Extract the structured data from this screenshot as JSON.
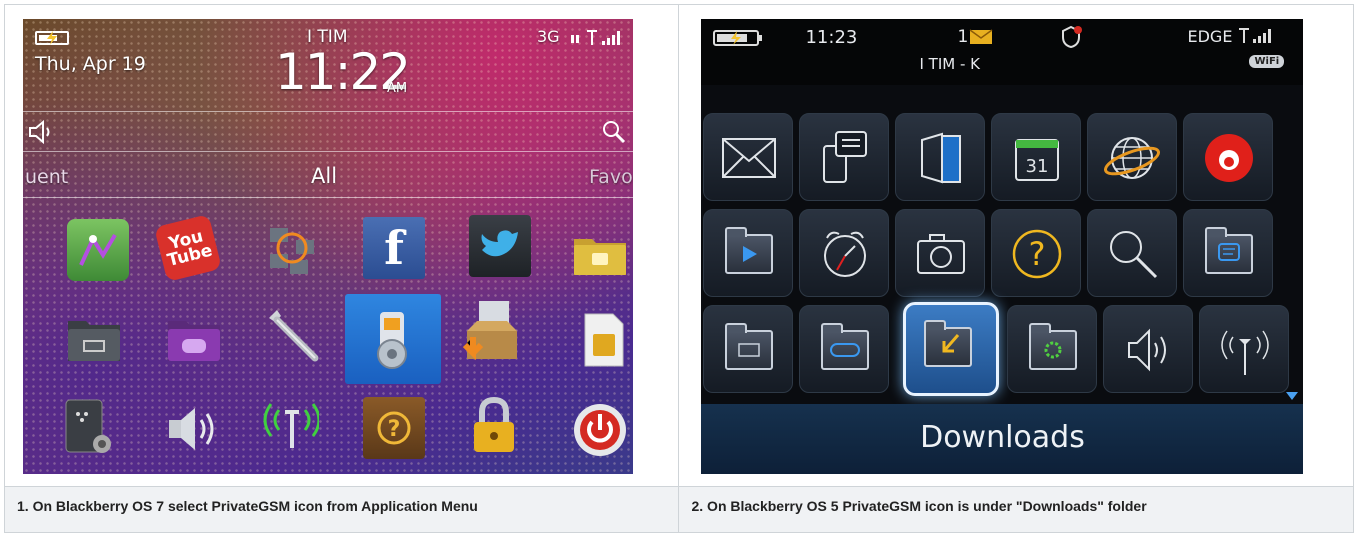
{
  "captions": [
    "1. On Blackberry OS 7 select PrivateGSM icon from Application Menu",
    "2. On Blackberry OS 5 PrivateGSM icon is under \"Downloads\" folder"
  ],
  "os7": {
    "carrier": "I TIM",
    "network": "3G",
    "date": "Thu, Apr 19",
    "time": "11:22",
    "ampm": "AM",
    "tabs": [
      "uent",
      "All",
      "Favo"
    ],
    "youtube_text": "You\nTube",
    "facebook_letter": "f",
    "icons": [
      "maps-icon",
      "youtube-icon",
      "social-feeds-icon",
      "facebook-icon",
      "twitter-icon",
      "messages-folder-icon",
      "folder-icon",
      "games-folder-icon",
      "wrench-icon",
      "privategsm-icon",
      "app-installer-icon",
      "sim-card-icon",
      "blackberry-options-icon",
      "speaker-icon",
      "wifi-icon",
      "help-icon",
      "lock-icon",
      "power-icon"
    ]
  },
  "os5": {
    "time": "11:23",
    "msg_count": "1",
    "carrier": "I TIM - K",
    "network": "EDGE",
    "wifi": "WiFi",
    "calendar_day": "31",
    "selected_label": "Downloads",
    "icons": [
      "mail-icon",
      "messenger-icon",
      "contacts-icon",
      "calendar-icon",
      "browser-icon",
      "vodafone-icon",
      "media-folder-icon",
      "clock-icon",
      "camera-icon",
      "help-icon",
      "search-icon",
      "messages-folder-icon",
      "folder-icon",
      "games-folder-icon",
      "downloads-folder-icon",
      "settings-folder-icon",
      "speaker-icon",
      "antenna-icon"
    ]
  }
}
